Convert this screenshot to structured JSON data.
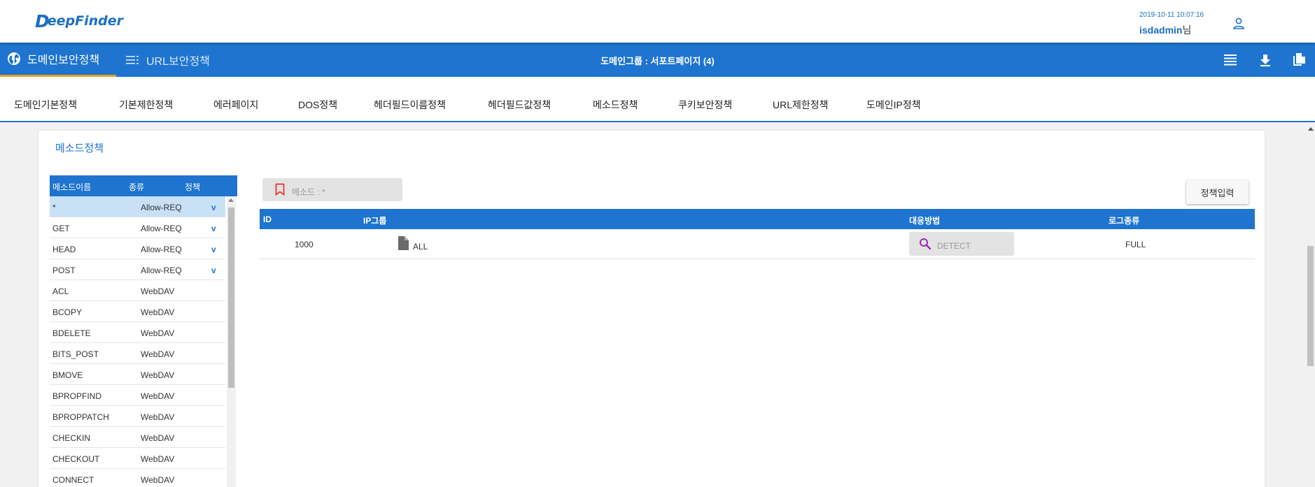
{
  "brand": {
    "logo_mark": "D",
    "logo_text": "eepFinder"
  },
  "header": {
    "datetime": "2019-10-11 10:07:16",
    "username": "isdadmin",
    "user_suffix": "님"
  },
  "nav": {
    "tabs": [
      {
        "label": "도메인보안정책",
        "icon": "globe-icon",
        "active": true
      },
      {
        "label": "URL보안정책",
        "icon": "list-icon",
        "active": false
      }
    ],
    "group_label": "도메인그룹 : 서포트페이지 (4)",
    "right_icons": [
      "menu-lines-icon",
      "download-icon",
      "copy-icon"
    ]
  },
  "subtabs": [
    "도메인기본정책",
    "기본제한정책",
    "에러페이지",
    "DOS정책",
    "헤더필드이름정책",
    "헤더필드값정책",
    "메소드정책",
    "쿠키보안정책",
    "URL제한정책",
    "도메인IP정책"
  ],
  "panel": {
    "title": "메소드정책"
  },
  "method_list": {
    "headers": {
      "name": "메소드이름",
      "type": "종류",
      "policy": "정책"
    },
    "rows": [
      {
        "name": "*",
        "type": "Allow-REQ",
        "check": "v",
        "selected": true
      },
      {
        "name": "GET",
        "type": "Allow-REQ",
        "check": "v"
      },
      {
        "name": "HEAD",
        "type": "Allow-REQ",
        "check": "v"
      },
      {
        "name": "POST",
        "type": "Allow-REQ",
        "check": "v"
      },
      {
        "name": "ACL",
        "type": "WebDAV",
        "check": ""
      },
      {
        "name": "BCOPY",
        "type": "WebDAV",
        "check": ""
      },
      {
        "name": "BDELETE",
        "type": "WebDAV",
        "check": ""
      },
      {
        "name": "BITS_POST",
        "type": "WebDAV",
        "check": ""
      },
      {
        "name": "BMOVE",
        "type": "WebDAV",
        "check": ""
      },
      {
        "name": "BPROPFIND",
        "type": "WebDAV",
        "check": ""
      },
      {
        "name": "BPROPPATCH",
        "type": "WebDAV",
        "check": ""
      },
      {
        "name": "CHECKIN",
        "type": "WebDAV",
        "check": ""
      },
      {
        "name": "CHECKOUT",
        "type": "WebDAV",
        "check": ""
      },
      {
        "name": "CONNECT",
        "type": "WebDAV",
        "check": ""
      }
    ]
  },
  "filter_chip": {
    "label": "메소드 : *",
    "icon": "bookmark-icon"
  },
  "policy_button": "정책입력",
  "rule_table": {
    "headers": {
      "id": "ID",
      "ip_group": "IP그룹",
      "response": "대응방법",
      "log_type": "로그종류"
    },
    "rows": [
      {
        "id": "1000",
        "ip_group": "ALL",
        "response": "DETECT",
        "log_type": "FULL"
      }
    ]
  },
  "colors": {
    "primary": "#1e74cf",
    "accent": "#f0a020",
    "selected_row": "#c9e1f7",
    "search_icon": "#9c27b0",
    "bookmark_icon": "#e53935"
  }
}
